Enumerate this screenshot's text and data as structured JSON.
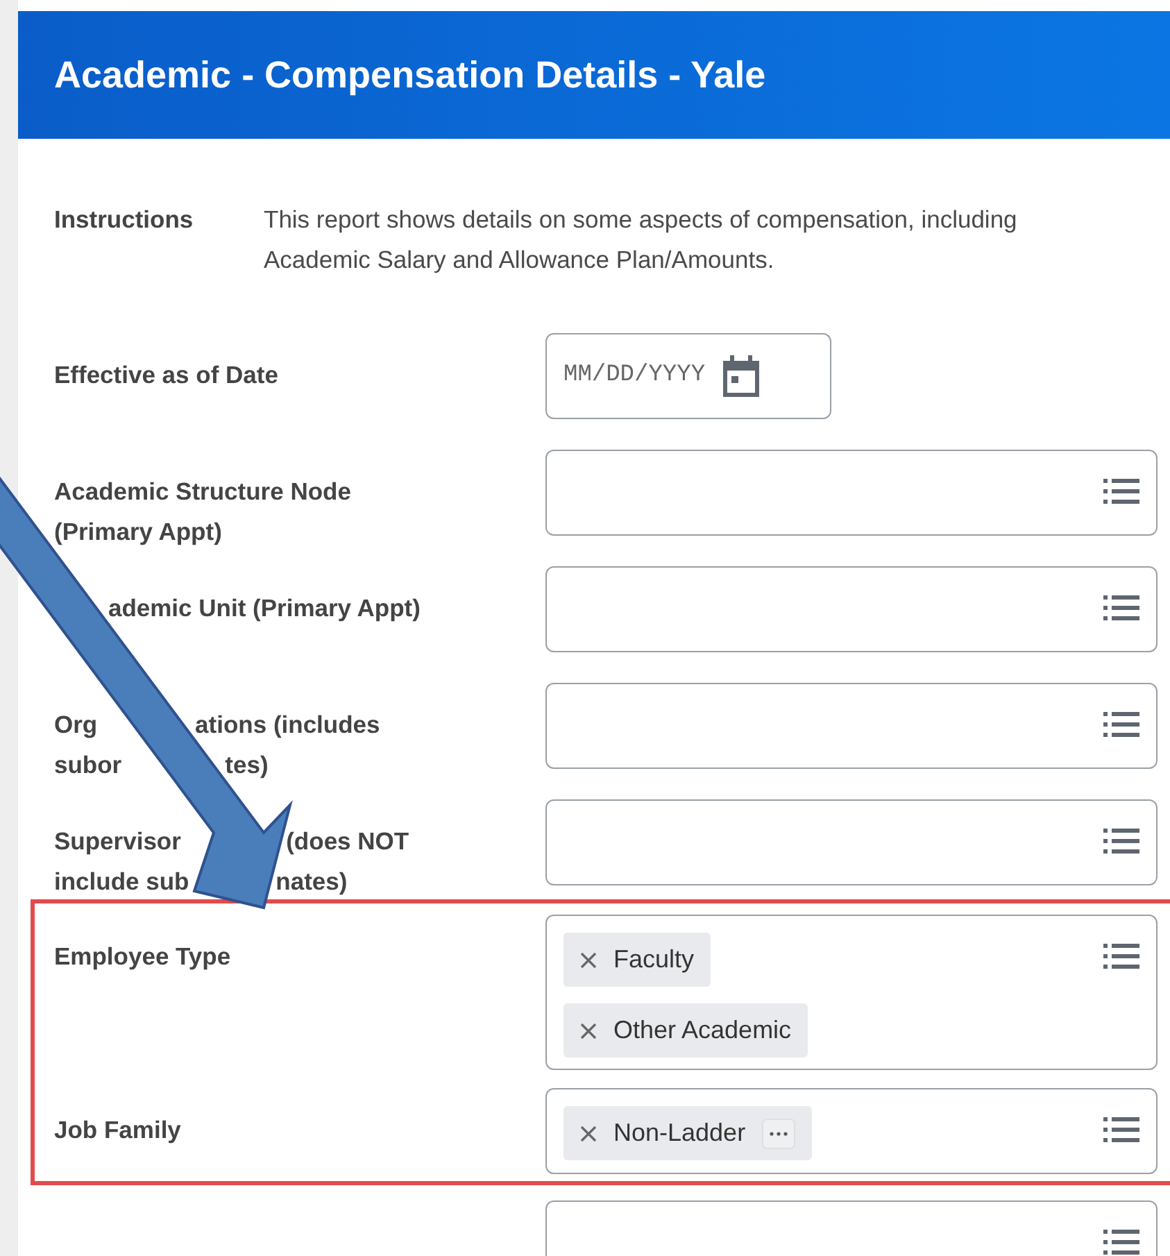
{
  "header": {
    "title": "Academic - Compensation Details - Yale"
  },
  "instructions": {
    "label": "Instructions",
    "text": "This report shows details on some aspects of compensation, including Academic Salary and Allowance Plan/Amounts."
  },
  "fields": [
    {
      "kind": "date",
      "label": [
        {
          "parts": [
            "Effective as of Date"
          ]
        }
      ],
      "placeholder": "MM/DD/YYYY",
      "highlighted": false
    },
    {
      "kind": "prompt",
      "label": [
        {
          "parts": [
            "Academic Structure Node"
          ]
        },
        {
          "parts": [
            "(Primary Appt)"
          ]
        }
      ],
      "highlighted": false
    },
    {
      "kind": "prompt",
      "label": [
        {
          "parts": [
            "ademic Unit (Primary Appt)"
          ],
          "lead_covered": true
        }
      ],
      "highlighted": false
    },
    {
      "kind": "prompt",
      "label": [
        {
          "parts": [
            "Org",
            "ations (includes"
          ]
        },
        {
          "parts": [
            "subor",
            "tes)"
          ]
        }
      ],
      "highlighted": false
    },
    {
      "kind": "prompt",
      "label": [
        {
          "parts": [
            "Supervisor",
            "(does NOT"
          ]
        },
        {
          "parts": [
            "include sub",
            "nates)"
          ]
        }
      ],
      "highlighted": false
    },
    {
      "kind": "prompt",
      "label": [
        {
          "parts": [
            "Employee Type"
          ]
        }
      ],
      "highlighted": true,
      "values": [
        {
          "text": "Faculty",
          "has_more": false
        },
        {
          "text": "Other Academic",
          "has_more": false
        }
      ]
    },
    {
      "kind": "prompt",
      "label": [
        {
          "parts": [
            "Job Family"
          ]
        }
      ],
      "highlighted": true,
      "values": [
        {
          "text": "Non-Ladder",
          "has_more": true
        }
      ]
    },
    {
      "kind": "prompt",
      "highlighted": false
    }
  ],
  "annotation": {
    "arrow": true
  }
}
